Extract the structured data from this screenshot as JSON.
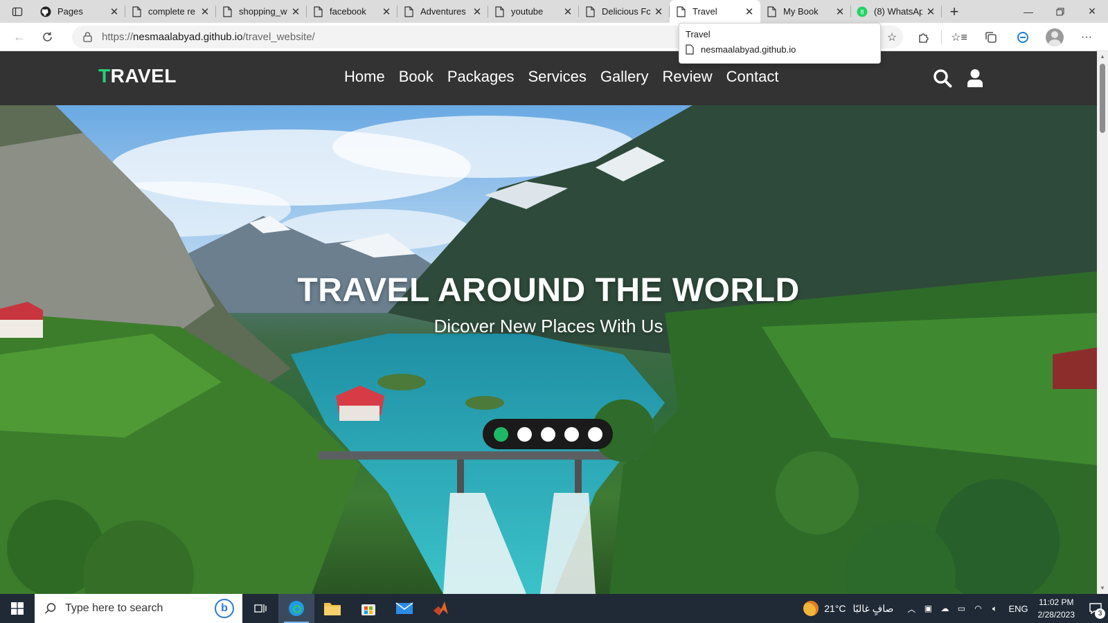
{
  "browser": {
    "tabs": [
      {
        "title": "Pages",
        "icon": "github-icon"
      },
      {
        "title": "complete re",
        "icon": "page-icon"
      },
      {
        "title": "shopping_w",
        "icon": "page-icon"
      },
      {
        "title": "facebook",
        "icon": "page-icon"
      },
      {
        "title": "Adventures",
        "icon": "page-icon"
      },
      {
        "title": "youtube",
        "icon": "page-icon"
      },
      {
        "title": "Delicious Fc",
        "icon": "page-icon"
      },
      {
        "title": "Travel",
        "icon": "page-icon",
        "active": true
      },
      {
        "title": "My Book",
        "icon": "page-icon"
      },
      {
        "title": "(8) WhatsAp",
        "icon": "whatsapp-icon"
      }
    ],
    "url_prefix": "https://",
    "url_host": "nesmaalabyad.github.io",
    "url_path": "/travel_website/",
    "tooltip": {
      "title": "Travel",
      "host": "nesmaalabyad.github.io"
    }
  },
  "site": {
    "logo_first": "T",
    "logo_rest": "RAVEL",
    "nav": [
      "Home",
      "Book",
      "Packages",
      "Services",
      "Gallery",
      "Review",
      "Contact"
    ],
    "hero_title": "TRAVEL AROUND THE WORLD",
    "hero_subtitle": "Dicover New Places With Us",
    "slider": {
      "count": 5,
      "active_index": 0
    },
    "colors": {
      "accent": "#29d07a",
      "header_bg": "#333333",
      "active_dot": "#20b866"
    }
  },
  "taskbar": {
    "search_placeholder": "Type here to search",
    "weather_temp": "21°C",
    "weather_text": "صافٍ غالبًا",
    "language": "ENG",
    "time": "11:02 PM",
    "date": "2/28/2023",
    "notification_count": "3"
  }
}
